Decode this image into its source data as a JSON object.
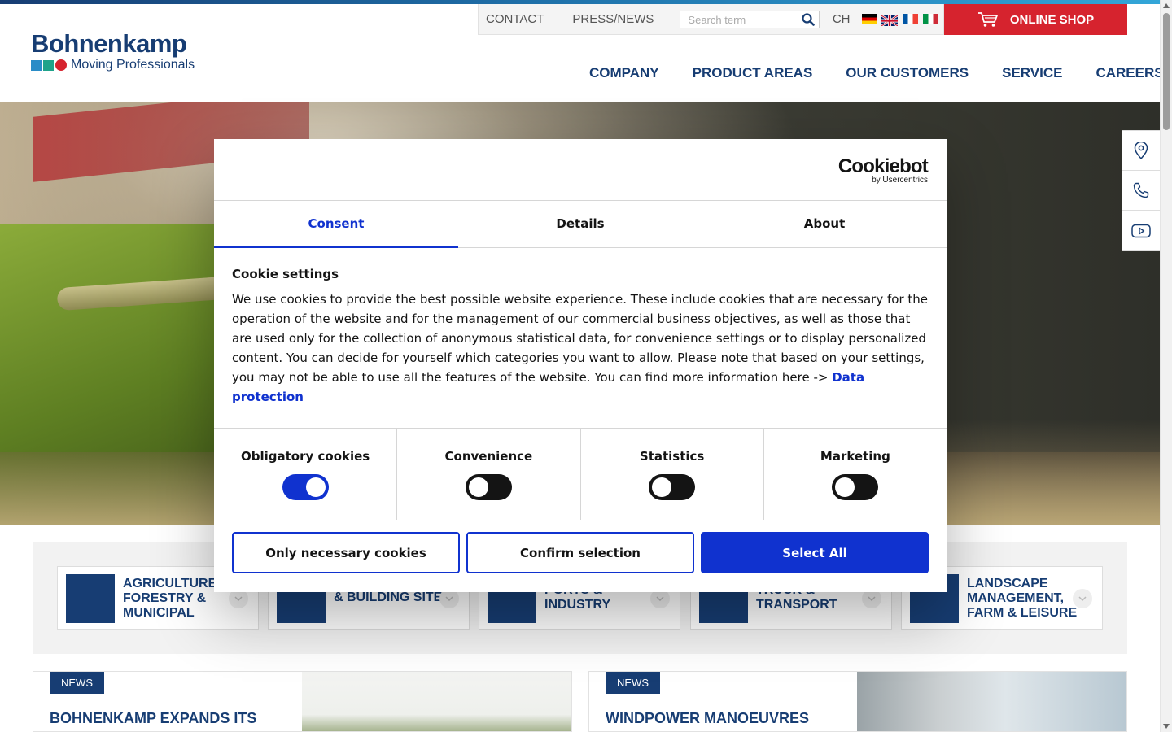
{
  "header": {
    "logo_name": "Bohnenkamp",
    "logo_tagline": "Moving Professionals",
    "brand_colors": {
      "navy": "#173d73",
      "teal": "#2a8cc7",
      "green": "#1fa38a",
      "red": "#d6232e"
    },
    "util_links": {
      "contact": "CONTACT",
      "press": "PRESS/NEWS"
    },
    "search_placeholder": "Search term",
    "lang_code": "CH",
    "flags": [
      "german-flag",
      "uk-flag",
      "french-flag",
      "italian-flag"
    ],
    "online_shop": "ONLINE SHOP",
    "nav": [
      "COMPANY",
      "PRODUCT AREAS",
      "OUR CUSTOMERS",
      "SERVICE",
      "CAREERS"
    ]
  },
  "side_tools": [
    "location-pin-icon",
    "phone-icon",
    "youtube-icon"
  ],
  "product_areas": [
    {
      "label": "AGRICULTURE, FORESTRY & MUNICIPAL"
    },
    {
      "label": "& BUILDING SITE"
    },
    {
      "label": "PORTS & INDUSTRY"
    },
    {
      "label": "TRUCK & TRANSPORT"
    },
    {
      "label": "LANDSCAPE MANAGEMENT, FARM & LEISURE"
    }
  ],
  "news": [
    {
      "badge": "NEWS",
      "title": "BOHNENKAMP EXPANDS ITS"
    },
    {
      "badge": "NEWS",
      "title": "WINDPOWER MANOEUVRES"
    }
  ],
  "cookie_dialog": {
    "brand": "Cookiebot",
    "brand_sub": "by Usercentrics",
    "tabs": [
      "Consent",
      "Details",
      "About"
    ],
    "active_tab": "Consent",
    "heading": "Cookie settings",
    "body_text": "We use cookies to provide the best possible website experience.  These include cookies that are necessary for the operation of the website and for the management of our commercial business objectives, as well as those that are used only for the collection of anonymous statistical data, for convenience settings or to display personalized content. You can decide for yourself which categories you want to allow. Please note that based on your settings, you may not be able to use all the features of the website.  You can find more information here -> ",
    "link_text": "Data protection",
    "toggles": [
      {
        "label": "Obligatory cookies",
        "checked": true
      },
      {
        "label": "Convenience",
        "checked": false
      },
      {
        "label": "Statistics",
        "checked": false
      },
      {
        "label": "Marketing",
        "checked": false
      }
    ],
    "buttons": {
      "necessary": "Only necessary cookies",
      "confirm": "Confirm selection",
      "select_all": "Select All"
    },
    "accent_color": "#1032cf"
  }
}
